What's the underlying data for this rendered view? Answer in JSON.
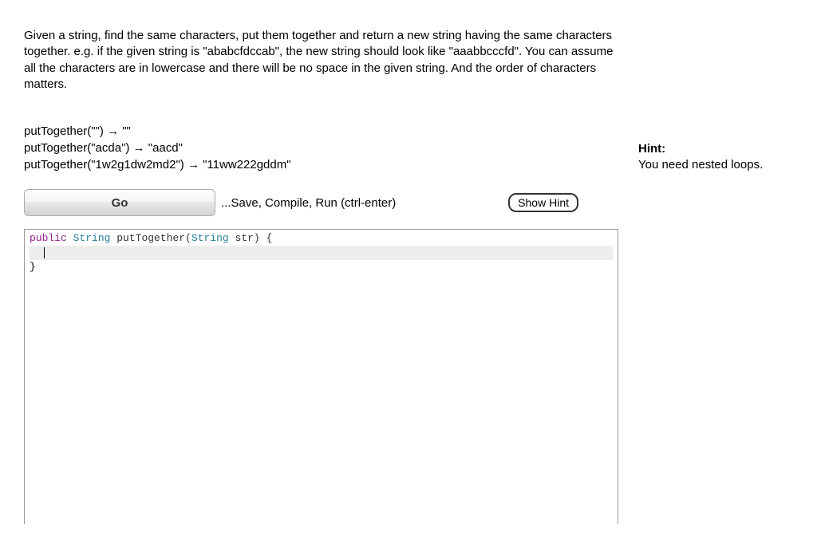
{
  "description": "Given a string, find the same characters, put them together and return a new string having the same characters together. e.g. if the given string is \"ababcfdccab\", the new string should look like \"aaabbcccfd\". You can assume all the characters are in lowercase and there will be no space in the given string. And the order of characters matters.",
  "examples": [
    {
      "call": "putTogether(\"\")",
      "arrow": "→",
      "result": "\"\""
    },
    {
      "call": "putTogether(\"acda\")",
      "arrow": "→",
      "result": "\"aacd\""
    },
    {
      "call": "putTogether(\"1w2g1dw2md2\")",
      "arrow": "→",
      "result": "\"11ww222gddm\""
    }
  ],
  "controls": {
    "go_label": "Go",
    "helper_text": "...Save, Compile, Run (ctrl-enter)",
    "show_hint_label": "Show Hint"
  },
  "editor": {
    "line1": {
      "kw_public": "public",
      "sp1": " ",
      "kw_ret": "String",
      "sp2": " ",
      "fn": "putTogether",
      "open": "(",
      "kw_param_type": "String",
      "sp3": " ",
      "param_name": "str",
      "close_brace": ") {"
    },
    "line2": "  ",
    "line3": "}"
  },
  "hint": {
    "label": "Hint:",
    "text": "You need nested loops."
  }
}
